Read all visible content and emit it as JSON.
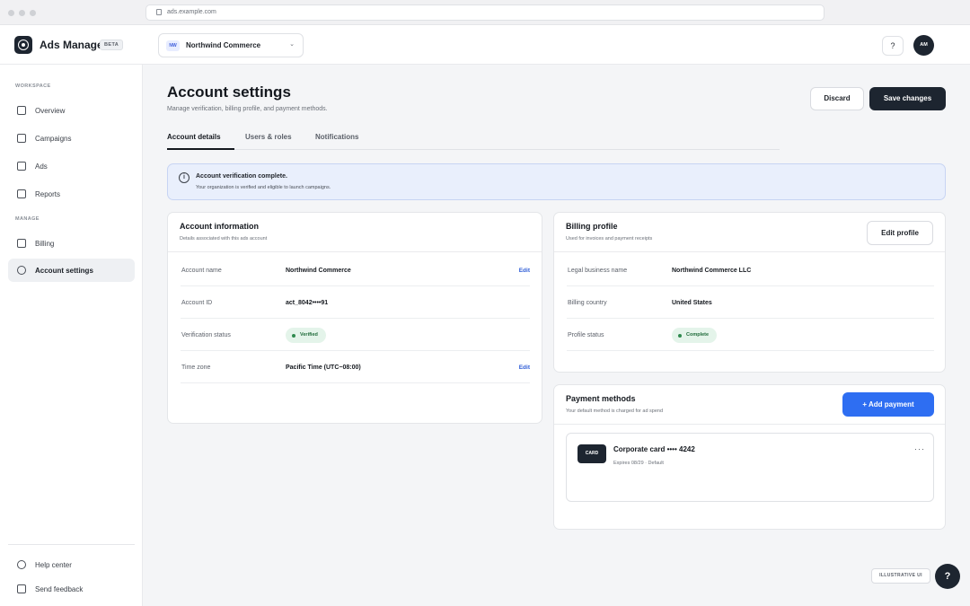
{
  "browser": {
    "url": "ads.example.com"
  },
  "header": {
    "app_name": "Ads Manager",
    "beta_badge": "BETA",
    "account_initials": "NW",
    "account_name": "Northwind Commerce",
    "help_label": "?",
    "avatar_initials": "AM"
  },
  "sidebar": {
    "workspace_label": "WORKSPACE",
    "manage_label": "MANAGE",
    "workspace_items": [
      {
        "label": "Overview",
        "icon": "square-icon"
      },
      {
        "label": "Campaigns",
        "icon": "square-icon"
      },
      {
        "label": "Ads",
        "icon": "square-icon"
      },
      {
        "label": "Reports",
        "icon": "square-icon"
      }
    ],
    "manage_items": [
      {
        "label": "Billing",
        "icon": "square-icon"
      },
      {
        "label": "Account settings",
        "icon": "circle-icon",
        "active": true
      }
    ],
    "footer_items": [
      {
        "label": "Help center",
        "icon": "circle-icon"
      },
      {
        "label": "Send feedback",
        "icon": "square-icon"
      }
    ]
  },
  "page": {
    "title": "Account settings",
    "subtitle": "Manage verification, billing profile, and payment methods.",
    "discard_label": "Discard",
    "save_label": "Save changes",
    "tabs": [
      {
        "label": "Account details",
        "active": true
      },
      {
        "label": "Users & roles"
      },
      {
        "label": "Notifications"
      }
    ]
  },
  "alert": {
    "icon": "info-icon",
    "title": "Account verification complete.",
    "text": "Your organization is verified and eligible to launch campaigns."
  },
  "account_info": {
    "title": "Account information",
    "subtitle": "Details associated with this ads account",
    "edit_label": "Edit",
    "rows": [
      {
        "label": "Account name",
        "value": "Northwind Commerce",
        "editable": true
      },
      {
        "label": "Account ID",
        "value": "act_8042••••91"
      },
      {
        "label": "Verification status",
        "value": "Verified",
        "status_color": "#2f8a4e"
      },
      {
        "label": "Time zone",
        "value": "Pacific Time (UTC−08:00)",
        "editable": true
      }
    ]
  },
  "billing_profile": {
    "title": "Billing profile",
    "subtitle": "Used for invoices and payment receipts",
    "edit_profile_label": "Edit profile",
    "rows": [
      {
        "label": "Legal business name",
        "value": "Northwind Commerce LLC"
      },
      {
        "label": "Billing country",
        "value": "United States"
      },
      {
        "label": "Profile status",
        "value": "Complete",
        "status_color": "#2f8a4e"
      }
    ]
  },
  "payment_methods": {
    "title": "Payment methods",
    "subtitle": "Your default method is charged for ad spend",
    "add_label": "+ Add payment",
    "accent_color": "#2e6ef2",
    "items": [
      {
        "chip": "CARD",
        "name": "Corporate card •••• 4242",
        "meta": "Expires 08/29 · Default",
        "more": "···"
      }
    ]
  },
  "footer": {
    "tag": "ILLUSTRATIVE UI",
    "fab_label": "?"
  }
}
